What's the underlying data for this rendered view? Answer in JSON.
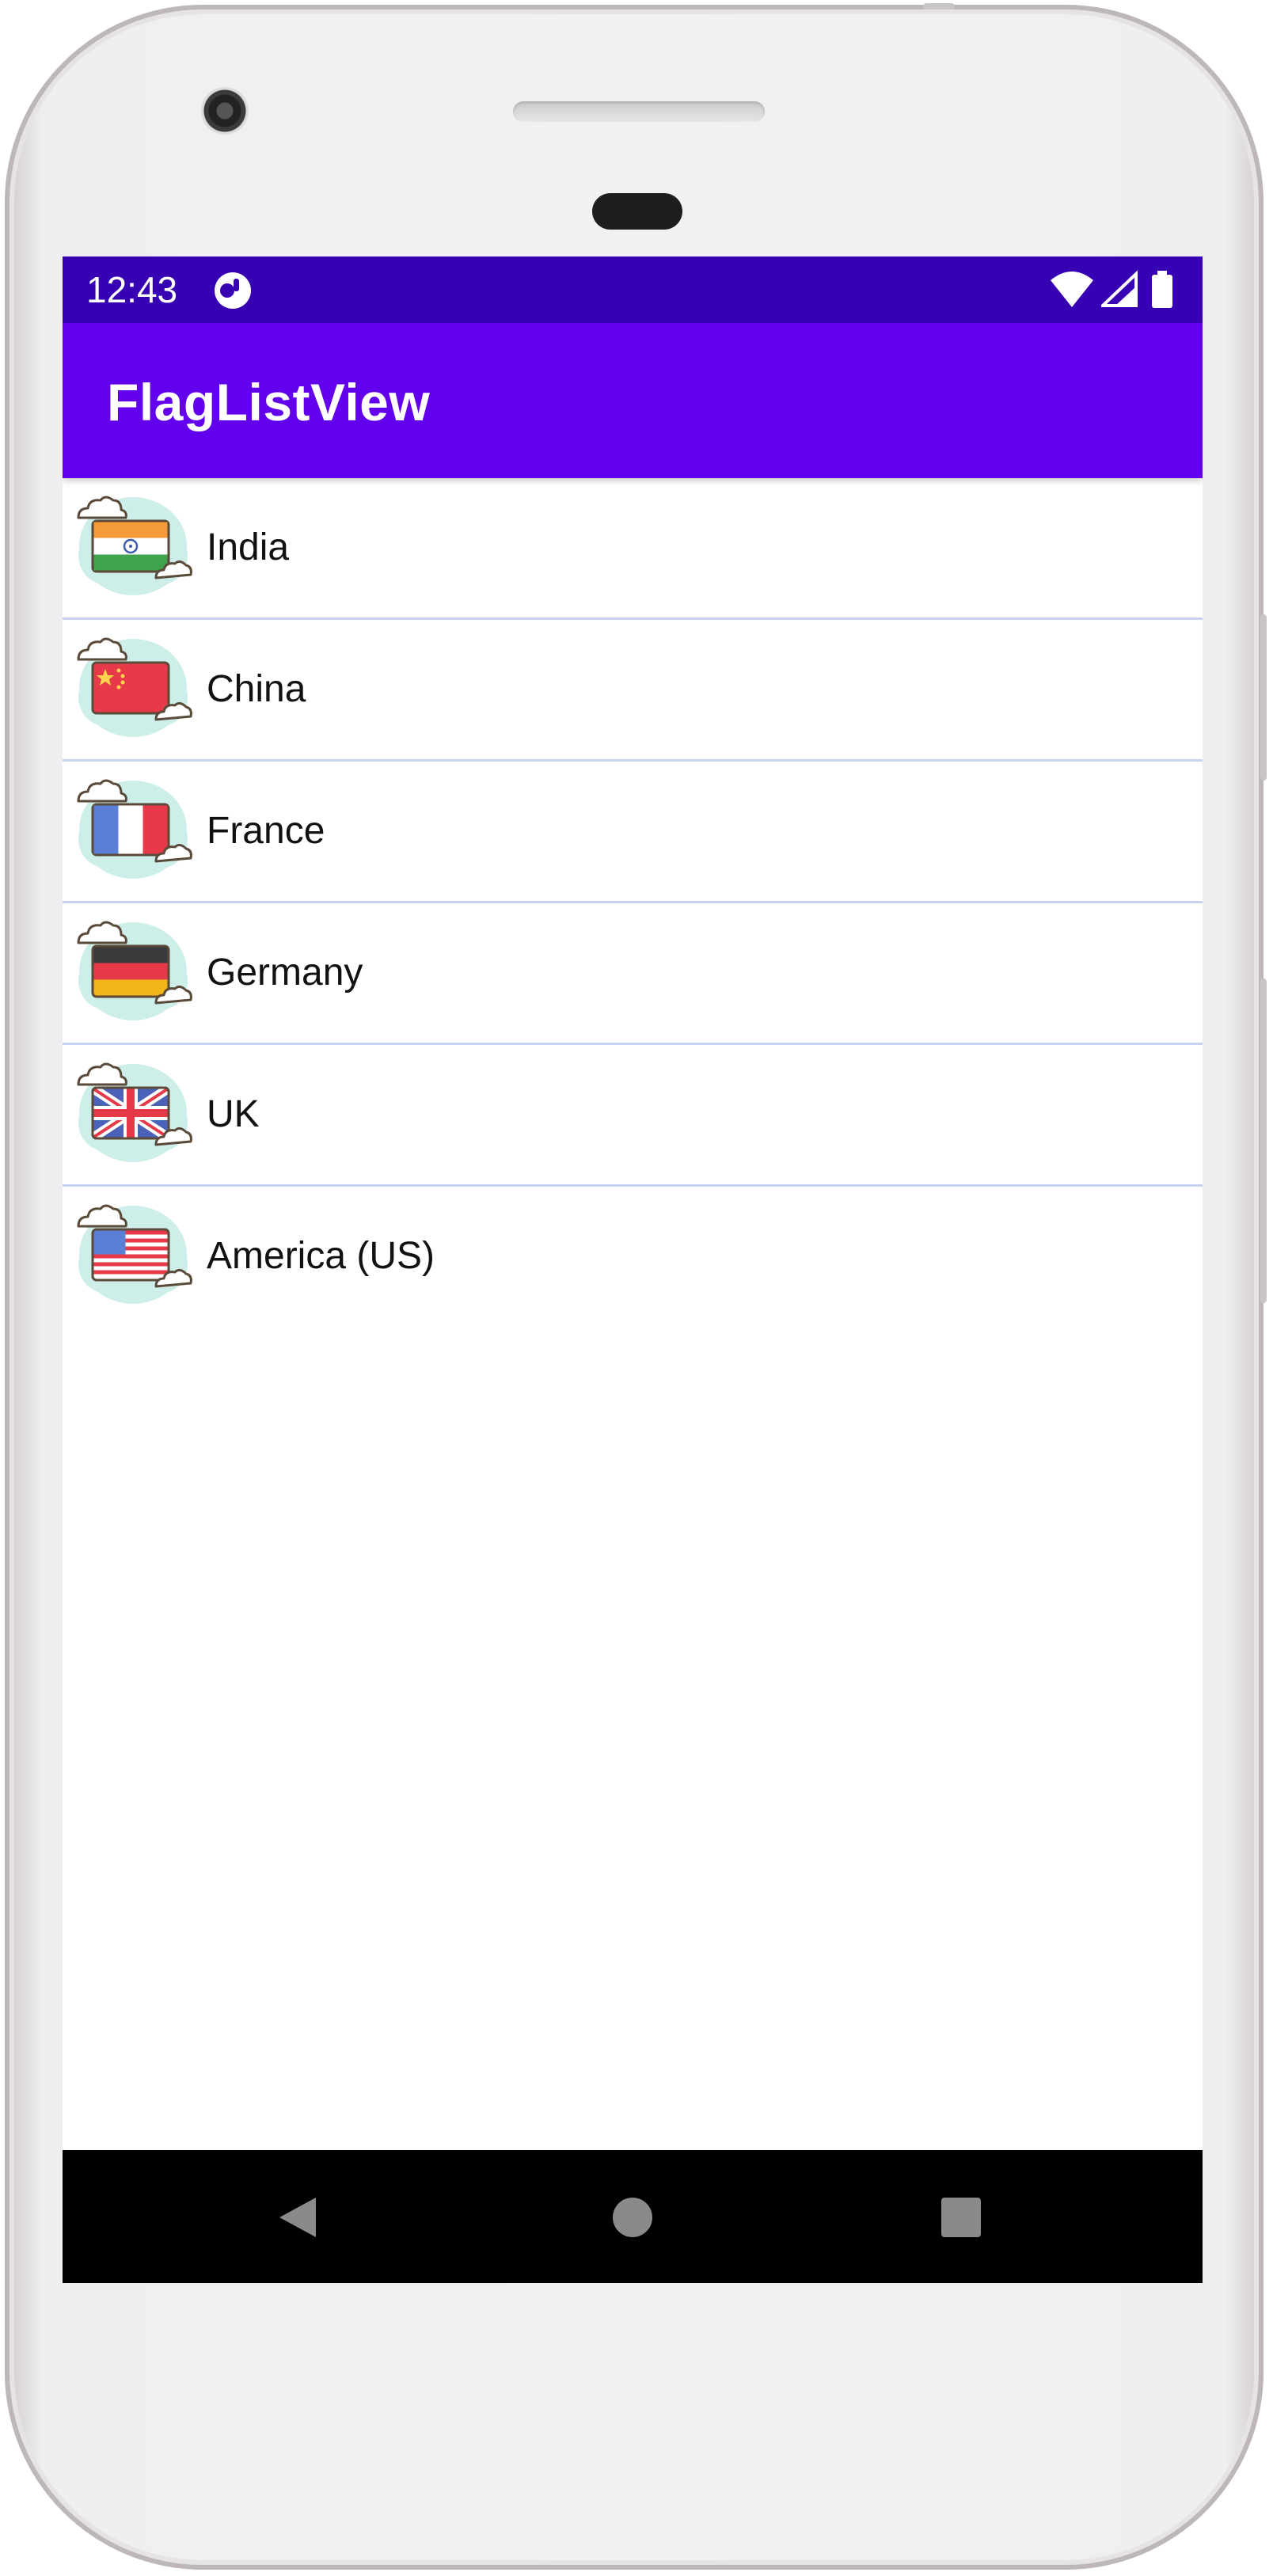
{
  "status_bar": {
    "time": "12:43",
    "icons": [
      "app-notification-icon",
      "wifi-icon",
      "signal-icon",
      "battery-icon"
    ],
    "background": "#3700b3"
  },
  "app_bar": {
    "title": "FlagListView",
    "background": "#6200ee"
  },
  "list": {
    "items": [
      {
        "label": "India",
        "icon": "india-flag-icon"
      },
      {
        "label": "China",
        "icon": "china-flag-icon"
      },
      {
        "label": "France",
        "icon": "france-flag-icon"
      },
      {
        "label": "Germany",
        "icon": "germany-flag-icon"
      },
      {
        "label": "UK",
        "icon": "uk-flag-icon"
      },
      {
        "label": "America (US)",
        "icon": "us-flag-icon"
      }
    ],
    "divider_color": "#c7d4f0"
  },
  "nav_bar": {
    "buttons": [
      "back-icon",
      "home-icon",
      "recents-icon"
    ]
  }
}
